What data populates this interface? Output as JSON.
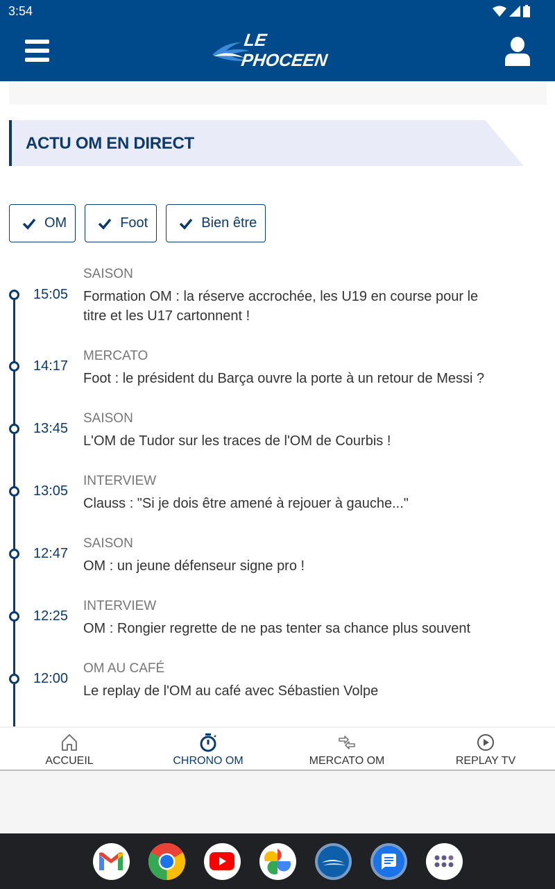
{
  "status_bar": {
    "time": "3:54"
  },
  "header": {
    "logo_text": "LE PHOCEEN"
  },
  "section": {
    "title": "ACTU OM EN DIRECT"
  },
  "filters": [
    {
      "label": "OM",
      "checked": true
    },
    {
      "label": "Foot",
      "checked": true
    },
    {
      "label": "Bien être",
      "checked": true
    }
  ],
  "timeline": [
    {
      "time": "15:05",
      "category": "SAISON",
      "title": "Formation OM : la réserve accrochée, les U19 en course pour le titre et les U17 cartonnent !"
    },
    {
      "time": "14:17",
      "category": "MERCATO",
      "title": "Foot : le président du Barça ouvre la porte à un retour de Messi ?"
    },
    {
      "time": "13:45",
      "category": "SAISON",
      "title": "L'OM de Tudor sur les traces de l'OM de Courbis !"
    },
    {
      "time": "13:05",
      "category": "INTERVIEW",
      "title": "Clauss : \"Si je dois être amené à rejouer à gauche...\""
    },
    {
      "time": "12:47",
      "category": "SAISON",
      "title": "OM : un jeune défenseur signe pro !"
    },
    {
      "time": "12:25",
      "category": "INTERVIEW",
      "title": "OM : Rongier regrette de ne pas tenter sa chance plus souvent"
    },
    {
      "time": "12:00",
      "category": "OM AU CAFÉ",
      "title": "Le replay de l'OM au café avec Sébastien Volpe"
    }
  ],
  "bottom_nav": [
    {
      "label": "ACCUEIL",
      "icon": "home-icon",
      "active": false
    },
    {
      "label": "CHRONO OM",
      "icon": "stopwatch-icon",
      "active": true
    },
    {
      "label": "MERCATO OM",
      "icon": "transfer-arrows-icon",
      "active": false
    },
    {
      "label": "REPLAY TV",
      "icon": "play-circle-icon",
      "active": false
    }
  ],
  "dock": [
    {
      "name": "Gmail"
    },
    {
      "name": "Chrome"
    },
    {
      "name": "YouTube"
    },
    {
      "name": "Photos"
    },
    {
      "name": "Le Phoceen"
    },
    {
      "name": "Messages"
    },
    {
      "name": "App drawer"
    }
  ],
  "colors": {
    "header_bg": "#004a8c",
    "primary_text": "#0b3a6e",
    "section_bg": "#e9ecf8",
    "category_text": "#767676",
    "dock_bg": "#202124"
  }
}
